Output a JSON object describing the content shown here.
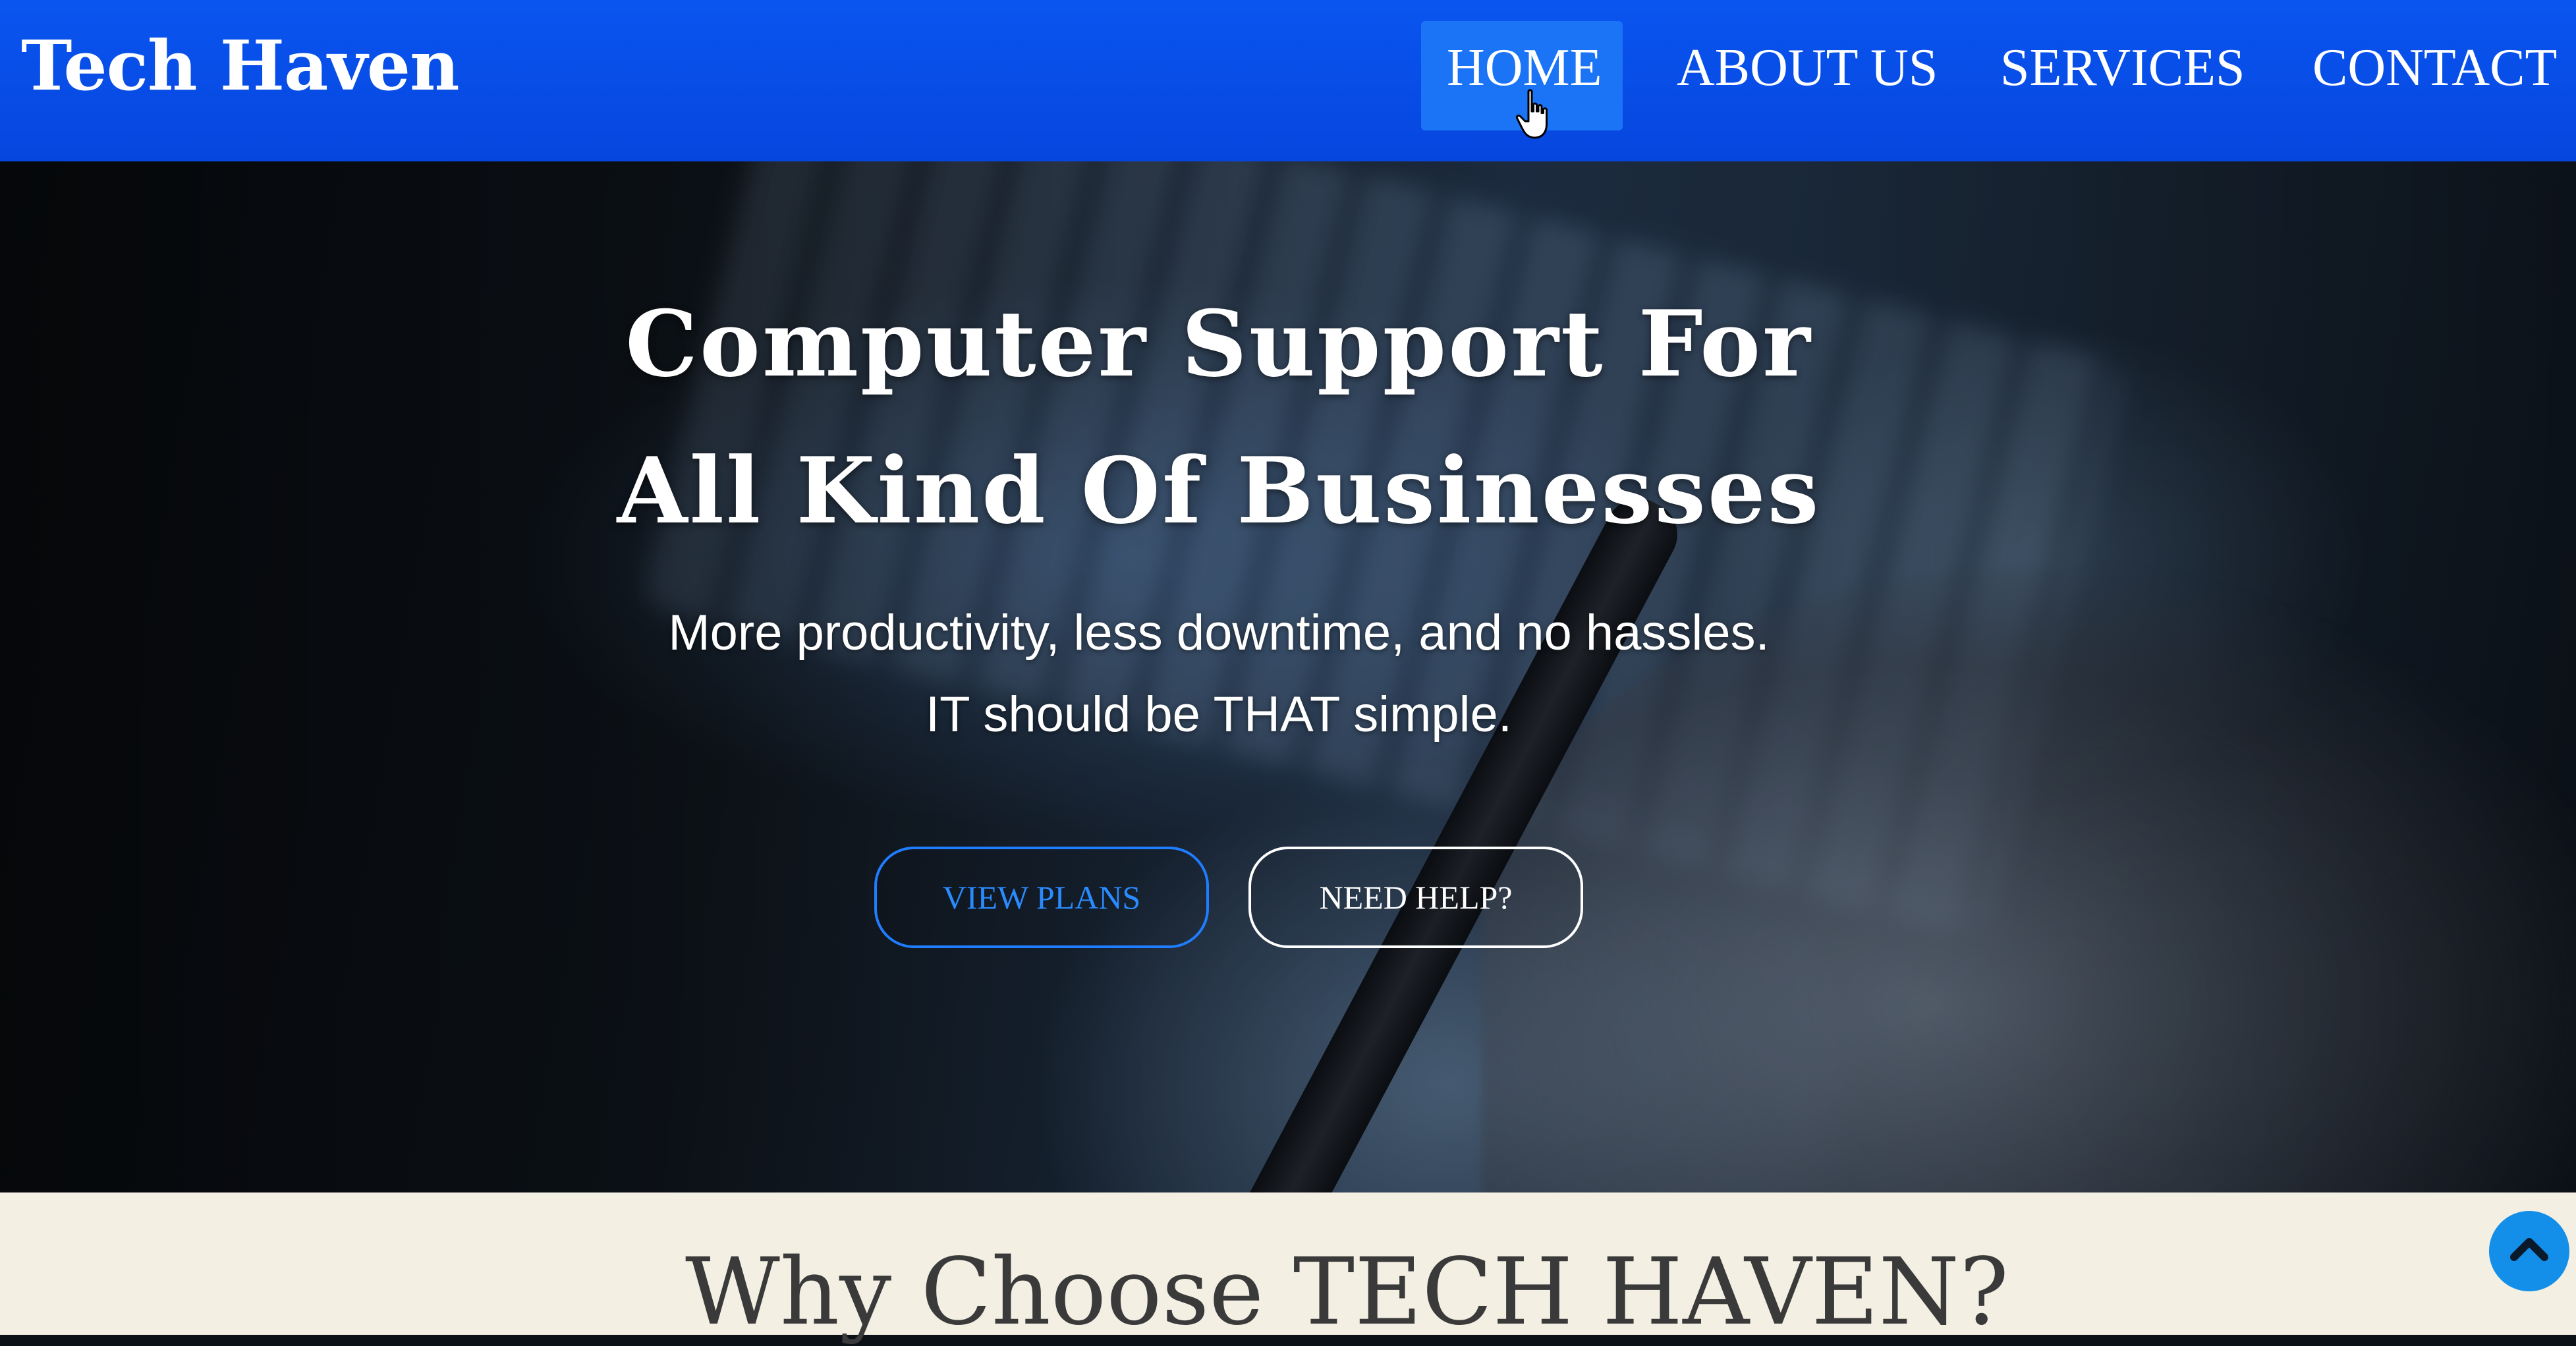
{
  "navbar": {
    "brand": "Tech Haven",
    "items": [
      {
        "label": "HOME",
        "active": true
      },
      {
        "label": "ABOUT US"
      },
      {
        "label": "SERVICES"
      },
      {
        "label": "CONTACT"
      }
    ]
  },
  "hero": {
    "title_line1": "Computer Support For",
    "title_line2": "All Kind Of Businesses",
    "subtitle_line1": "More productivity, less downtime, and no hassles.",
    "subtitle_line2": "IT should be THAT simple.",
    "buttons": {
      "view_plans": "VIEW PLANS",
      "need_help": "NEED HELP?"
    }
  },
  "section": {
    "title": "Why Choose TECH HAVEN?"
  },
  "icons": {
    "cursor": "hand-pointer-icon",
    "scroll_top": "chevron-up-icon"
  },
  "colors": {
    "navbar": "#0646de",
    "nav_active": "#1a74f5",
    "accent": "#1f7dff",
    "section_bg": "#f3efe3",
    "scroll_top": "#138fe9"
  }
}
